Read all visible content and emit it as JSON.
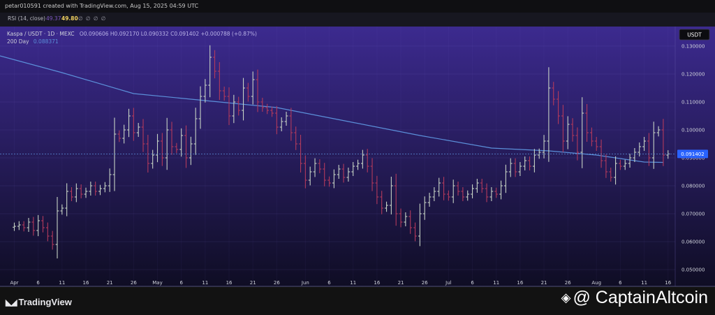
{
  "header": {
    "created_by": "petar010591 created with TradingView.com, Aug 15, 2025 04:59 UTC"
  },
  "rsi": {
    "label": "RSI (14, close)",
    "value_a": "49.37",
    "value_b": "49.80",
    "empty": "∅ ∅ ∅ ∅"
  },
  "legend": {
    "symbol": "Kaspa / USDT · 1D · MEXC",
    "ohlc": "O0.090606 H0.092170 L0.090332 C0.091402 +0.000788 (+0.87%)",
    "ma_label": "200 Day",
    "ma_value": "0.088371"
  },
  "currency_badge": "USDT",
  "price_badge": "0.091402",
  "branding": {
    "tv_logo": "TradingView",
    "watermark": "@ CaptainAltcoin"
  },
  "colors": {
    "bg_top": "#3c2a8f",
    "bg_bottom": "#0f0d24",
    "up": "#c7d3c5",
    "down": "#b23a5c",
    "ma": "#5b8fd9",
    "badge": "#2962ff"
  },
  "chart_data": {
    "type": "ohlc-bar",
    "interval": "1D",
    "ylim": [
      0.044,
      0.137
    ],
    "y_ticks": [
      "0.130000",
      "0.120000",
      "0.110000",
      "0.100000",
      "0.090000",
      "0.080000",
      "0.070000",
      "0.060000",
      "0.050000"
    ],
    "y_tick_values": [
      0.13,
      0.12,
      0.11,
      0.1,
      0.09,
      0.08,
      0.07,
      0.06,
      0.05
    ],
    "x_labels": [
      {
        "label": "Apr",
        "day": 0
      },
      {
        "label": "6",
        "day": 5
      },
      {
        "label": "11",
        "day": 10
      },
      {
        "label": "16",
        "day": 15
      },
      {
        "label": "21",
        "day": 20
      },
      {
        "label": "26",
        "day": 25
      },
      {
        "label": "May",
        "day": 30
      },
      {
        "label": "6",
        "day": 35
      },
      {
        "label": "11",
        "day": 40
      },
      {
        "label": "16",
        "day": 45
      },
      {
        "label": "21",
        "day": 50
      },
      {
        "label": "26",
        "day": 55
      },
      {
        "label": "Jun",
        "day": 61
      },
      {
        "label": "6",
        "day": 66
      },
      {
        "label": "11",
        "day": 71
      },
      {
        "label": "16",
        "day": 76
      },
      {
        "label": "21",
        "day": 81
      },
      {
        "label": "26",
        "day": 86
      },
      {
        "label": "Jul",
        "day": 91
      },
      {
        "label": "6",
        "day": 96
      },
      {
        "label": "11",
        "day": 101
      },
      {
        "label": "16",
        "day": 106
      },
      {
        "label": "21",
        "day": 111
      },
      {
        "label": "26",
        "day": 116
      },
      {
        "label": "Aug",
        "day": 122
      },
      {
        "label": "6",
        "day": 127
      },
      {
        "label": "11",
        "day": 132
      },
      {
        "label": "16",
        "day": 137
      }
    ],
    "day_range": [
      -3,
      138.5
    ],
    "last_day": 136,
    "close_series": [
      0.0655,
      0.066,
      0.065,
      0.067,
      0.064,
      0.0675,
      0.065,
      0.062,
      0.059,
      0.071,
      0.072,
      0.078,
      0.076,
      0.079,
      0.077,
      0.078,
      0.08,
      0.078,
      0.079,
      0.08,
      0.084,
      0.0985,
      0.097,
      0.1,
      0.105,
      0.099,
      0.101,
      0.095,
      0.088,
      0.091,
      0.096,
      0.09,
      0.1,
      0.094,
      0.093,
      0.098,
      0.09,
      0.095,
      0.104,
      0.112,
      0.116,
      0.126,
      0.121,
      0.114,
      0.112,
      0.105,
      0.11,
      0.107,
      0.115,
      0.112,
      0.118,
      0.11,
      0.108,
      0.107,
      0.106,
      0.101,
      0.103,
      0.105,
      0.099,
      0.095,
      0.088,
      0.082,
      0.085,
      0.088,
      0.086,
      0.082,
      0.081,
      0.084,
      0.086,
      0.083,
      0.085,
      0.087,
      0.088,
      0.091,
      0.087,
      0.081,
      0.076,
      0.072,
      0.073,
      0.08,
      0.07,
      0.067,
      0.069,
      0.065,
      0.062,
      0.07,
      0.074,
      0.076,
      0.078,
      0.081,
      0.077,
      0.076,
      0.08,
      0.078,
      0.076,
      0.077,
      0.079,
      0.081,
      0.079,
      0.076,
      0.078,
      0.077,
      0.08,
      0.085,
      0.088,
      0.085,
      0.087,
      0.089,
      0.087,
      0.091,
      0.092,
      0.096,
      0.115,
      0.111,
      0.105,
      0.096,
      0.102,
      0.098,
      0.092,
      0.106,
      0.099,
      0.096,
      0.094,
      0.089,
      0.085,
      0.083,
      0.088,
      0.087,
      0.088,
      0.09,
      0.092,
      0.094,
      0.096,
      0.09,
      0.099,
      0.1,
      0.091,
      0.0914
    ],
    "ma_200d": [
      {
        "day": -3,
        "value": 0.1265
      },
      {
        "day": 10,
        "value": 0.1205
      },
      {
        "day": 25,
        "value": 0.113
      },
      {
        "day": 40,
        "value": 0.1105
      },
      {
        "day": 55,
        "value": 0.108
      },
      {
        "day": 70,
        "value": 0.103
      },
      {
        "day": 85,
        "value": 0.098
      },
      {
        "day": 100,
        "value": 0.0935
      },
      {
        "day": 112,
        "value": 0.0925
      },
      {
        "day": 122,
        "value": 0.091
      },
      {
        "day": 132,
        "value": 0.0885
      },
      {
        "day": 136,
        "value": 0.08837
      }
    ]
  }
}
